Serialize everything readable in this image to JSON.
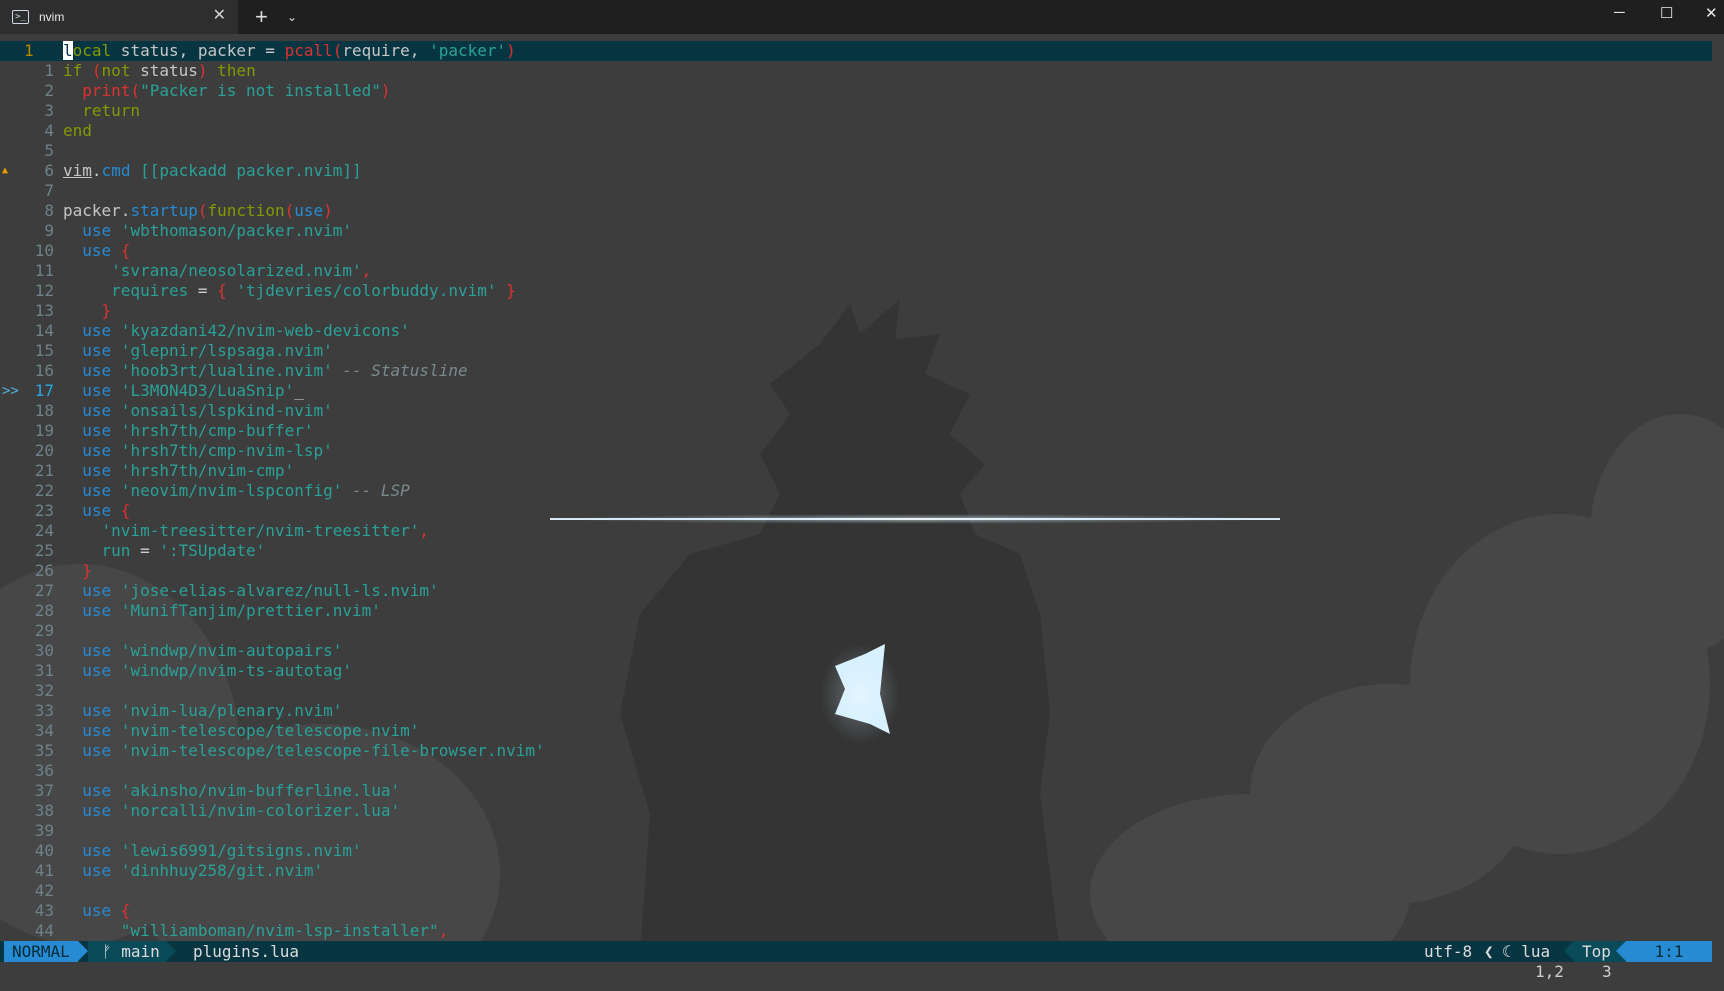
{
  "window": {
    "tab_icon_glyph": ">_",
    "tab_title": "nvim",
    "tab_close": "✕",
    "new_tab": "+",
    "tab_dropdown": "⌄",
    "minimize": "─",
    "maximize": "☐",
    "close": "✕"
  },
  "editor": {
    "lines": [
      {
        "num": "1",
        "current": true,
        "tokens": [
          [
            "cursor",
            "l"
          ],
          [
            "kw",
            "ocal"
          ],
          [
            "var",
            " status, packer "
          ],
          [
            "op",
            "="
          ],
          [
            "fn",
            " pcall"
          ],
          [
            "brace",
            "("
          ],
          [
            "var",
            "require, "
          ],
          [
            "str",
            "'packer'"
          ],
          [
            "brace",
            ")"
          ]
        ]
      },
      {
        "num": "1",
        "tokens": [
          [
            "kw",
            "if "
          ],
          [
            "brace",
            "("
          ],
          [
            "kw",
            "not"
          ],
          [
            "var",
            " status"
          ],
          [
            "brace",
            ")"
          ],
          [
            "kw",
            " then"
          ]
        ]
      },
      {
        "num": "2",
        "tokens": [
          [
            "var",
            "  "
          ],
          [
            "fn",
            "print"
          ],
          [
            "brace",
            "("
          ],
          [
            "str",
            "\"Packer is not installed\""
          ],
          [
            "brace",
            ")"
          ]
        ]
      },
      {
        "num": "3",
        "tokens": [
          [
            "kw",
            "  return"
          ]
        ]
      },
      {
        "num": "4",
        "tokens": [
          [
            "kw",
            "end"
          ]
        ]
      },
      {
        "num": "5",
        "tokens": []
      },
      {
        "num": "6",
        "sign": "▲",
        "tokens": [
          [
            "ul",
            "vim"
          ],
          [
            "var",
            "."
          ],
          [
            "use",
            "cmd"
          ],
          [
            "str",
            " [[packadd packer.nvim]]"
          ]
        ]
      },
      {
        "num": "7",
        "tokens": []
      },
      {
        "num": "8",
        "tokens": [
          [
            "var",
            "packer."
          ],
          [
            "use",
            "startup"
          ],
          [
            "brace",
            "("
          ],
          [
            "kw",
            "function"
          ],
          [
            "brace",
            "("
          ],
          [
            "use",
            "use"
          ],
          [
            "brace",
            ")"
          ]
        ]
      },
      {
        "num": "9",
        "tokens": [
          [
            "var",
            "  "
          ],
          [
            "use",
            "use"
          ],
          [
            "str",
            " 'wbthomason/packer.nvim'"
          ]
        ]
      },
      {
        "num": "10",
        "tokens": [
          [
            "var",
            "  "
          ],
          [
            "use",
            "use"
          ],
          [
            "brace",
            " {"
          ]
        ]
      },
      {
        "num": "11",
        "tokens": [
          [
            "str",
            "     'svrana/neosolarized.nvim'"
          ],
          [
            "brace",
            ","
          ]
        ]
      },
      {
        "num": "12",
        "tokens": [
          [
            "str",
            "     requires "
          ],
          [
            "op",
            "="
          ],
          [
            "brace",
            " {"
          ],
          [
            "str",
            " 'tjdevries/colorbuddy.nvim' "
          ],
          [
            "brace",
            "}"
          ]
        ]
      },
      {
        "num": "13",
        "tokens": [
          [
            "brace",
            "    }"
          ]
        ]
      },
      {
        "num": "14",
        "tokens": [
          [
            "var",
            "  "
          ],
          [
            "use",
            "use"
          ],
          [
            "str",
            " 'kyazdani42/nvim-web-devicons'"
          ]
        ]
      },
      {
        "num": "15",
        "tokens": [
          [
            "var",
            "  "
          ],
          [
            "use",
            "use"
          ],
          [
            "str",
            " 'glepnir/lspsaga.nvim'"
          ]
        ]
      },
      {
        "num": "16",
        "tokens": [
          [
            "var",
            "  "
          ],
          [
            "use",
            "use"
          ],
          [
            "str",
            " 'hoob3rt/lualine.nvim'"
          ],
          [
            "com",
            " -- Statusline"
          ]
        ]
      },
      {
        "num": "17",
        "sign": ">>",
        "marked": true,
        "tokens": [
          [
            "var",
            "  "
          ],
          [
            "use",
            "use"
          ],
          [
            "str",
            " 'L3MON4D3/LuaSnip'"
          ],
          [
            "var",
            "_"
          ]
        ]
      },
      {
        "num": "18",
        "tokens": [
          [
            "var",
            "  "
          ],
          [
            "use",
            "use"
          ],
          [
            "str",
            " 'onsails/lspkind-nvim'"
          ]
        ]
      },
      {
        "num": "19",
        "tokens": [
          [
            "var",
            "  "
          ],
          [
            "use",
            "use"
          ],
          [
            "str",
            " 'hrsh7th/cmp-buffer'"
          ]
        ]
      },
      {
        "num": "20",
        "tokens": [
          [
            "var",
            "  "
          ],
          [
            "use",
            "use"
          ],
          [
            "str",
            " 'hrsh7th/cmp-nvim-lsp'"
          ]
        ]
      },
      {
        "num": "21",
        "tokens": [
          [
            "var",
            "  "
          ],
          [
            "use",
            "use"
          ],
          [
            "str",
            " 'hrsh7th/nvim-cmp'"
          ]
        ]
      },
      {
        "num": "22",
        "tokens": [
          [
            "var",
            "  "
          ],
          [
            "use",
            "use"
          ],
          [
            "str",
            " 'neovim/nvim-lspconfig'"
          ],
          [
            "com",
            " -- LSP"
          ]
        ]
      },
      {
        "num": "23",
        "tokens": [
          [
            "var",
            "  "
          ],
          [
            "use",
            "use"
          ],
          [
            "brace",
            " {"
          ]
        ]
      },
      {
        "num": "24",
        "tokens": [
          [
            "str",
            "    'nvim-treesitter/nvim-treesitter'"
          ],
          [
            "brace",
            ","
          ]
        ]
      },
      {
        "num": "25",
        "tokens": [
          [
            "str",
            "    run "
          ],
          [
            "op",
            "="
          ],
          [
            "str",
            " ':TSUpdate'"
          ]
        ]
      },
      {
        "num": "26",
        "tokens": [
          [
            "brace",
            "  }"
          ]
        ]
      },
      {
        "num": "27",
        "tokens": [
          [
            "var",
            "  "
          ],
          [
            "use",
            "use"
          ],
          [
            "str",
            " 'jose-elias-alvarez/null-ls.nvim'"
          ]
        ]
      },
      {
        "num": "28",
        "tokens": [
          [
            "var",
            "  "
          ],
          [
            "use",
            "use"
          ],
          [
            "str",
            " 'MunifTanjim/prettier.nvim'"
          ]
        ]
      },
      {
        "num": "29",
        "tokens": []
      },
      {
        "num": "30",
        "tokens": [
          [
            "var",
            "  "
          ],
          [
            "use",
            "use"
          ],
          [
            "str",
            " 'windwp/nvim-autopairs'"
          ]
        ]
      },
      {
        "num": "31",
        "tokens": [
          [
            "var",
            "  "
          ],
          [
            "use",
            "use"
          ],
          [
            "str",
            " 'windwp/nvim-ts-autotag'"
          ]
        ]
      },
      {
        "num": "32",
        "tokens": []
      },
      {
        "num": "33",
        "tokens": [
          [
            "var",
            "  "
          ],
          [
            "use",
            "use"
          ],
          [
            "str",
            " 'nvim-lua/plenary.nvim'"
          ]
        ]
      },
      {
        "num": "34",
        "tokens": [
          [
            "var",
            "  "
          ],
          [
            "use",
            "use"
          ],
          [
            "str",
            " 'nvim-telescope/telescope.nvim'"
          ]
        ]
      },
      {
        "num": "35",
        "tokens": [
          [
            "var",
            "  "
          ],
          [
            "use",
            "use"
          ],
          [
            "str",
            " 'nvim-telescope/telescope-file-browser.nvim'"
          ]
        ]
      },
      {
        "num": "36",
        "tokens": []
      },
      {
        "num": "37",
        "tokens": [
          [
            "var",
            "  "
          ],
          [
            "use",
            "use"
          ],
          [
            "str",
            " 'akinsho/nvim-bufferline.lua'"
          ]
        ]
      },
      {
        "num": "38",
        "tokens": [
          [
            "var",
            "  "
          ],
          [
            "use",
            "use"
          ],
          [
            "str",
            " 'norcalli/nvim-colorizer.lua'"
          ]
        ]
      },
      {
        "num": "39",
        "tokens": []
      },
      {
        "num": "40",
        "tokens": [
          [
            "var",
            "  "
          ],
          [
            "use",
            "use"
          ],
          [
            "str",
            " 'lewis6991/gitsigns.nvim'"
          ]
        ]
      },
      {
        "num": "41",
        "tokens": [
          [
            "var",
            "  "
          ],
          [
            "use",
            "use"
          ],
          [
            "str",
            " 'dinhhuy258/git.nvim'"
          ]
        ]
      },
      {
        "num": "42",
        "tokens": []
      },
      {
        "num": "43",
        "tokens": [
          [
            "var",
            "  "
          ],
          [
            "use",
            "use"
          ],
          [
            "brace",
            " {"
          ]
        ]
      },
      {
        "num": "44",
        "tokens": [
          [
            "str",
            "      \"williamboman/nvim-lsp-installer\""
          ],
          [
            "brace",
            ","
          ]
        ]
      }
    ]
  },
  "statusline": {
    "mode": "NORMAL",
    "branch_icon": "ᚠ",
    "branch": "main",
    "file": "plugins.lua",
    "encoding": "utf-8",
    "separator": "❮",
    "filetype_icon": "☾",
    "filetype": "lua",
    "position": "Top",
    "location": "1:1"
  },
  "ruler": {
    "cursor": "1,2",
    "count": "3"
  }
}
